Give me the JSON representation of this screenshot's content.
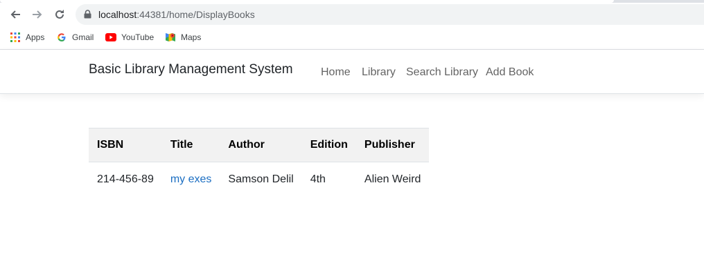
{
  "browser": {
    "url_host": "localhost",
    "url_rest": ":44381/home/DisplayBooks",
    "bookmarks": [
      {
        "label": "Apps",
        "icon": "apps-grid-icon"
      },
      {
        "label": "Gmail",
        "icon": "google-g-icon"
      },
      {
        "label": "YouTube",
        "icon": "youtube-icon"
      },
      {
        "label": "Maps",
        "icon": "maps-icon"
      }
    ]
  },
  "navbar": {
    "brand": "Basic Library Management System",
    "links": [
      "Home",
      "Library",
      "Search Library",
      "Add Book"
    ]
  },
  "table": {
    "headers": [
      "ISBN",
      "Title",
      "Author",
      "Edition",
      "Publisher"
    ],
    "rows": [
      {
        "isbn": "214-456-89",
        "title": "my exes",
        "author": "Samson Delil",
        "edition": "4th",
        "publisher": "Alien Weird"
      }
    ]
  },
  "colors": {
    "link": "#1b6ec2",
    "header_bg": "#f2f2f2"
  }
}
